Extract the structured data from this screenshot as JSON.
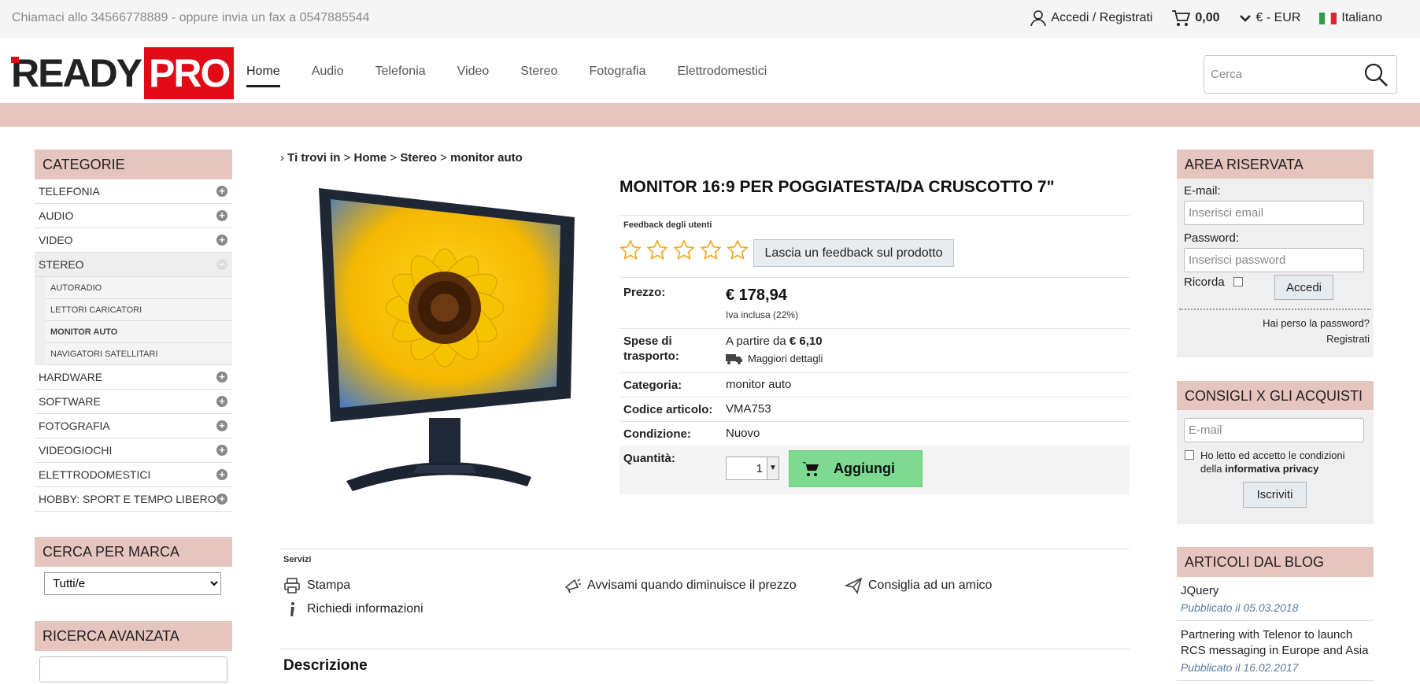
{
  "topbar": {
    "contact": "Chiamaci allo 34566778889 - oppure invia un fax a 0547885544",
    "login": "Accedi / Registrati",
    "cart_total": "0,00",
    "currency": "€ - EUR",
    "language": "Italiano"
  },
  "logo": {
    "ready": "READY",
    "pro": "PRO"
  },
  "nav": [
    "Home",
    "Audio",
    "Telefonia",
    "Video",
    "Stereo",
    "Fotografia",
    "Elettrodomestici"
  ],
  "search": {
    "placeholder": "Cerca"
  },
  "categories": {
    "title": "CATEGORIE",
    "items": [
      {
        "label": "TELEFONIA"
      },
      {
        "label": "AUDIO"
      },
      {
        "label": "VIDEO"
      },
      {
        "label": "STEREO"
      },
      {
        "label": "HARDWARE"
      },
      {
        "label": "SOFTWARE"
      },
      {
        "label": "FOTOGRAFIA"
      },
      {
        "label": "VIDEOGIOCHI"
      },
      {
        "label": "ELETTRODOMESTICI"
      },
      {
        "label": "HOBBY: SPORT E TEMPO LIBERO"
      }
    ],
    "stereo_sub": [
      "AUTORADIO",
      "LETTORI CARICATORI",
      "MONITOR AUTO",
      "NAVIGATORI SATELLITARI"
    ]
  },
  "brand": {
    "title": "CERCA PER MARCA",
    "selected": "Tutti/e"
  },
  "advanced": {
    "title": "RICERCA AVANZATA"
  },
  "breadcrumb": {
    "prefix": "Ti trovi in",
    "home": "Home",
    "section": "Stereo",
    "current": "monitor auto"
  },
  "product": {
    "title": "MONITOR 16:9 PER POGGIATESTA/DA CRUSCOTTO 7\"",
    "feedback_label": "Feedback degli utenti",
    "feedback_button": "Lascia un feedback sul prodotto",
    "price_label": "Prezzo:",
    "price": "€ 178,94",
    "vat": "Iva inclusa (22%)",
    "shipping_label": "Spese di trasporto:",
    "shipping_prefix": "A partire da",
    "shipping_value": "€ 6,10",
    "shipping_details": "Maggiori dettagli",
    "category_label": "Categoria:",
    "category": "monitor auto",
    "code_label": "Codice articolo:",
    "code": "VMA753",
    "condition_label": "Condizione:",
    "condition": "Nuovo",
    "quantity_label": "Quantità:",
    "quantity": "1",
    "add_button": "Aggiungi"
  },
  "services": {
    "label": "Servizi",
    "print": "Stampa",
    "price_alert": "Avvisami quando diminuisce il prezzo",
    "recommend": "Consiglia ad un amico",
    "info": "Richiedi informazioni"
  },
  "description_title": "Descrizione",
  "reserved": {
    "title": "AREA RISERVATA",
    "email_label": "E-mail:",
    "email_placeholder": "Inserisci email",
    "password_label": "Password:",
    "password_placeholder": "Inserisci password",
    "remember": "Ricorda",
    "login_button": "Accedi",
    "lost_password": "Hai perso la password?",
    "register": "Registrati"
  },
  "newsletter": {
    "title": "CONSIGLI X GLI ACQUISTI",
    "email_placeholder": "E-mail",
    "privacy_text": "Ho letto ed accetto le condizioni della",
    "privacy_link": "informativa privacy",
    "subscribe": "Iscriviti"
  },
  "blog": {
    "title": "ARTICOLI DAL BLOG",
    "entries": [
      {
        "title": "JQuery",
        "date": "Pubblicato il 05.03.2018"
      },
      {
        "title": "Partnering with Telenor to launch RCS messaging in Europe and Asia",
        "date": "Pubblicato il 16.02.2017"
      }
    ]
  },
  "colors": {
    "accent_pink": "#e6c5bf",
    "brand_red": "#e10b17",
    "add_green": "#7ed991"
  }
}
